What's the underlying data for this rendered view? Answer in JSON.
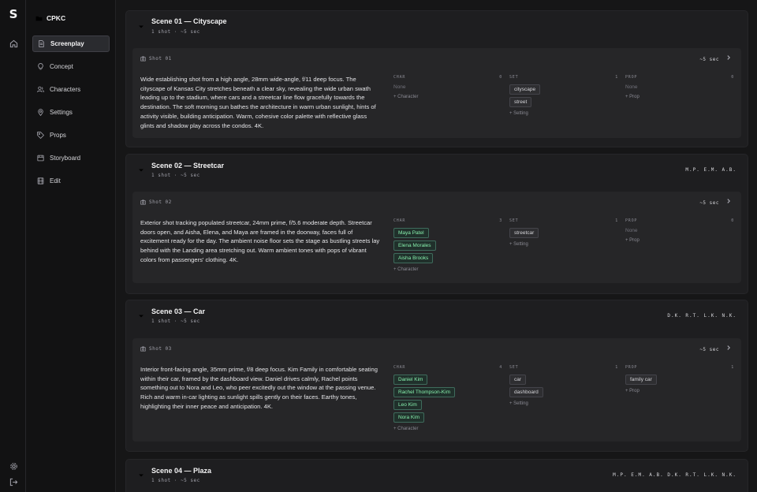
{
  "app": {
    "logo": "S",
    "project_name": "CPKC"
  },
  "nav": [
    {
      "label": "Screenplay",
      "icon": "document-icon",
      "active": true
    },
    {
      "label": "Concept",
      "icon": "lightbulb-icon"
    },
    {
      "label": "Characters",
      "icon": "users-icon"
    },
    {
      "label": "Settings",
      "icon": "map-pin-icon"
    },
    {
      "label": "Props",
      "icon": "tag-icon"
    },
    {
      "label": "Storyboard",
      "icon": "film-icon"
    },
    {
      "label": "Edit",
      "icon": "clapper-icon"
    }
  ],
  "labels": {
    "char": "CHAR",
    "set": "SET",
    "prop": "PROP",
    "none": "None",
    "add_character": "+ Character",
    "add_setting": "+ Setting",
    "add_prop": "+ Prop"
  },
  "scenes": [
    {
      "title": "Scene 01 — Cityscape",
      "meta": "1 shot · ~5 sec",
      "characters": "",
      "shot": {
        "label": "Shot 01",
        "duration": "~5 sec",
        "description": "Wide establishing shot from a high angle, 28mm wide-angle, f/11 deep focus. The cityscape of Kansas City stretches beneath a clear sky, revealing the wide urban swath leading up to the stadium, where cars and a streetcar line flow gracefully towards the destination. The soft morning sun bathes the architecture in warm urban sunlight, hints of activity visible, building anticipation. Warm, cohesive color palette with reflective glass glints and shadow play across the condos. 4K.",
        "char_count": "0",
        "set_count": "1",
        "prop_count": "0",
        "chars": [],
        "sets": [
          "cityscape",
          "street"
        ],
        "props": []
      }
    },
    {
      "title": "Scene 02 — Streetcar",
      "meta": "1 shot · ~5 sec",
      "characters": "M.P. E.M. A.B.",
      "shot": {
        "label": "Shot 02",
        "duration": "~5 sec",
        "description": "Exterior shot tracking populated streetcar, 24mm prime, f/5.6 moderate depth. Streetcar doors open, and Aisha, Elena, and Maya are framed in the doorway, faces full of excitement ready for the day. The ambient noise floor sets the stage as bustling streets lay behind with the Landing area stretching out. Warm ambient tones with pops of vibrant colors from passengers' clothing. 4K.",
        "char_count": "3",
        "set_count": "1",
        "prop_count": "0",
        "chars": [
          "Maya Patel",
          "Elena Morales",
          "Aisha Brooks"
        ],
        "sets": [
          "streetcar"
        ],
        "props": []
      }
    },
    {
      "title": "Scene 03 — Car",
      "meta": "1 shot · ~5 sec",
      "characters": "D.K. R.T. L.K. N.K.",
      "shot": {
        "label": "Shot 03",
        "duration": "~5 sec",
        "description": "Interior front-facing angle, 35mm prime, f/8 deep focus. Kim Family in comfortable seating within their car, framed by the dashboard view. Daniel drives calmly, Rachel points something out to Nora and Leo, who peer excitedly out the window at the passing venue. Rich and warm in-car lighting as sunlight spills gently on their faces. Earthy tones, highlighting their inner peace and anticipation. 4K.",
        "char_count": "4",
        "set_count": "1",
        "prop_count": "1",
        "chars": [
          "Daniel Kim",
          "Rachel Thompson-Kim",
          "Leo Kim",
          "Nora Kim"
        ],
        "sets": [
          "car",
          "dashboard"
        ],
        "props": [
          "family car"
        ]
      }
    },
    {
      "title": "Scene 04 — Plaza",
      "meta": "1 shot · ~5 sec",
      "characters": "M.P. E.M. A.B. D.K. R.T. L.K. N.K."
    }
  ]
}
